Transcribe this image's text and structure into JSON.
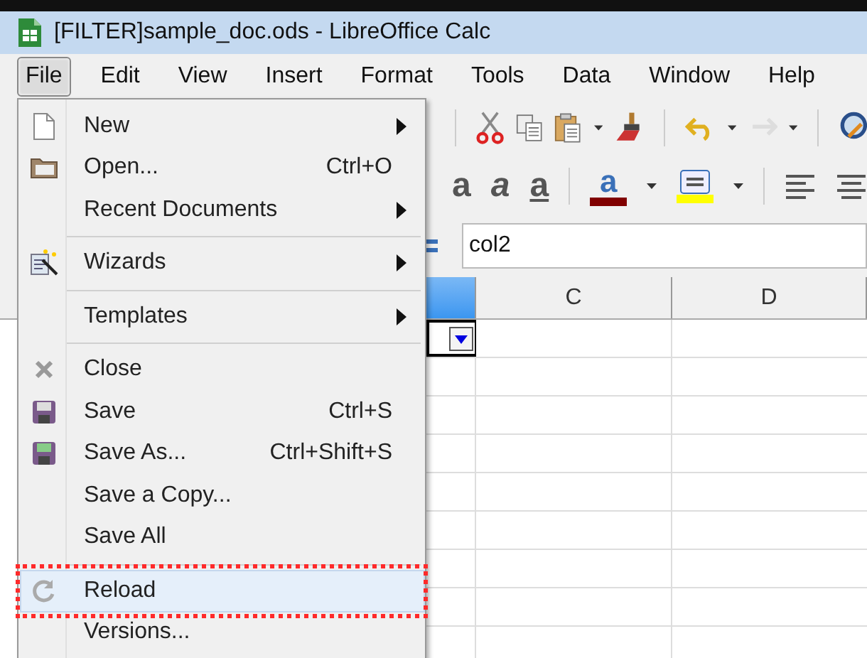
{
  "window": {
    "title": "[FILTER]sample_doc.ods - LibreOffice Calc"
  },
  "menubar": [
    {
      "label": "File",
      "selected": true
    },
    {
      "label": "Edit",
      "selected": false
    },
    {
      "label": "View",
      "selected": false
    },
    {
      "label": "Insert",
      "selected": false
    },
    {
      "label": "Format",
      "selected": false
    },
    {
      "label": "Tools",
      "selected": false
    },
    {
      "label": "Data",
      "selected": false
    },
    {
      "label": "Window",
      "selected": false
    },
    {
      "label": "Help",
      "selected": false
    }
  ],
  "file_menu": [
    {
      "kind": "item",
      "label": "New",
      "submenu": true,
      "selected": false,
      "highlighted": false
    },
    {
      "kind": "item",
      "label": "Open...",
      "shortcut": "Ctrl+O",
      "submenu": false,
      "selected": false,
      "highlighted": false
    },
    {
      "kind": "item",
      "label": "Recent Documents",
      "submenu": true,
      "selected": false,
      "highlighted": false
    },
    {
      "kind": "separator"
    },
    {
      "kind": "item",
      "label": "Wizards",
      "submenu": true,
      "selected": false,
      "highlighted": false
    },
    {
      "kind": "separator"
    },
    {
      "kind": "item",
      "label": "Templates",
      "submenu": true,
      "selected": false,
      "highlighted": false
    },
    {
      "kind": "separator"
    },
    {
      "kind": "item",
      "label": "Close",
      "submenu": false,
      "selected": false,
      "highlighted": false
    },
    {
      "kind": "item",
      "label": "Save",
      "shortcut": "Ctrl+S",
      "submenu": false,
      "selected": false,
      "highlighted": false
    },
    {
      "kind": "item",
      "label": "Save As...",
      "shortcut": "Ctrl+Shift+S",
      "submenu": false,
      "selected": false,
      "highlighted": false
    },
    {
      "kind": "item",
      "label": "Save a Copy...",
      "submenu": false,
      "selected": false,
      "highlighted": false
    },
    {
      "kind": "item",
      "label": "Save All",
      "submenu": false,
      "selected": false,
      "highlighted": false
    },
    {
      "kind": "separator"
    },
    {
      "kind": "item",
      "label": "Reload",
      "submenu": false,
      "selected": true,
      "highlighted": true
    },
    {
      "kind": "item",
      "label": "Versions...",
      "submenu": false,
      "selected": false,
      "highlighted": false
    }
  ],
  "toolbar": {
    "redo_disabled": true,
    "format_buttons": [
      {
        "kind": "bold",
        "label": "a"
      },
      {
        "kind": "italic",
        "label": "a"
      },
      {
        "kind": "underline",
        "label": "a"
      },
      {
        "kind": "font_color",
        "label": "a",
        "color": "#800000"
      },
      {
        "kind": "highlight",
        "color": "#ffff00"
      }
    ]
  },
  "formula_bar": {
    "value": "col2"
  },
  "sheet": {
    "partial_column_selected": true,
    "columns": [
      {
        "label": "C",
        "selected": false
      },
      {
        "label": "D",
        "selected": false
      }
    ],
    "autofilter": true
  }
}
